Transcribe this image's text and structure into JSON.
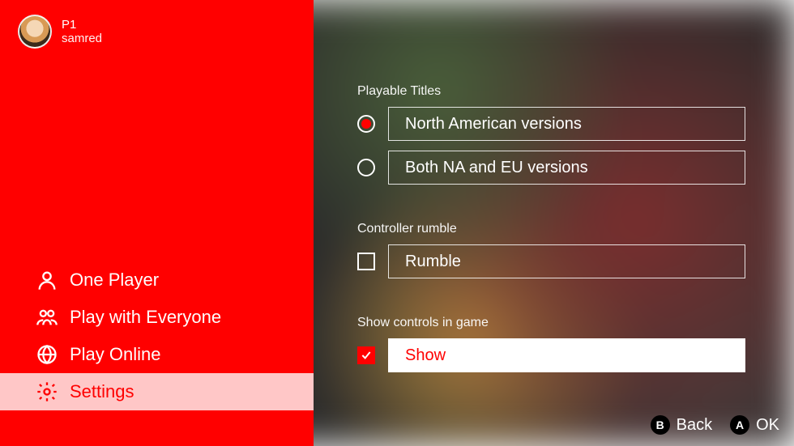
{
  "user": {
    "slot": "P1",
    "name": "samred"
  },
  "sidebar": {
    "items": [
      {
        "label": "One Player",
        "icon": "single-user-icon"
      },
      {
        "label": "Play with Everyone",
        "icon": "group-users-icon"
      },
      {
        "label": "Play Online",
        "icon": "globe-icon"
      },
      {
        "label": "Settings",
        "icon": "gear-icon",
        "selected": true
      }
    ]
  },
  "settings": {
    "playable_titles": {
      "label": "Playable Titles",
      "options": [
        {
          "label": "North American versions",
          "selected": true
        },
        {
          "label": "Both NA and EU versions",
          "selected": false
        }
      ]
    },
    "controller_rumble": {
      "label": "Controller rumble",
      "option_label": "Rumble",
      "checked": false
    },
    "show_controls": {
      "label": "Show controls in game",
      "option_label": "Show",
      "checked": true,
      "highlighted": true
    }
  },
  "footer": {
    "back": {
      "glyph": "B",
      "label": "Back"
    },
    "ok": {
      "glyph": "A",
      "label": "OK"
    }
  }
}
